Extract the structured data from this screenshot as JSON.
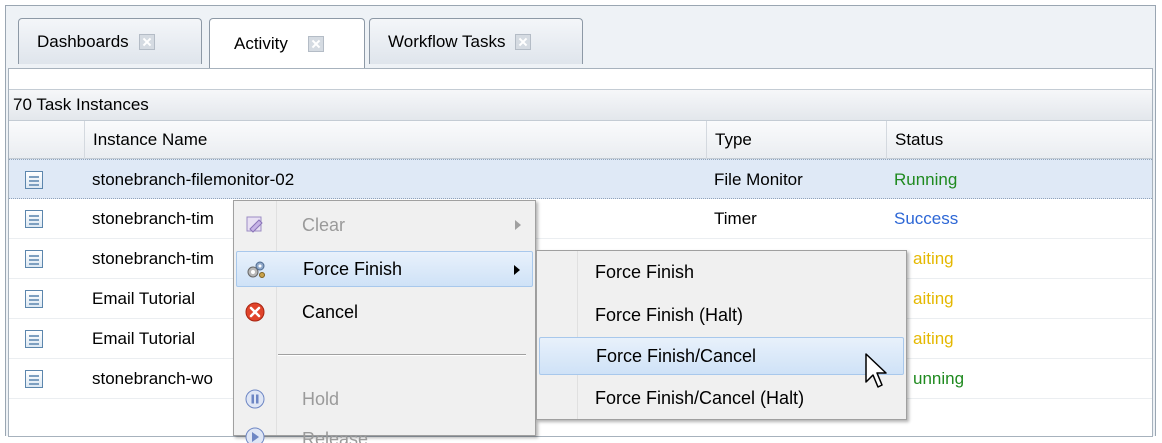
{
  "tabs": [
    {
      "label": "Dashboards"
    },
    {
      "label": "Activity"
    },
    {
      "label": "Workflow Tasks"
    }
  ],
  "grid": {
    "count_label": "70 Task Instances",
    "columns": {
      "name": "Instance Name",
      "type": "Type",
      "status": "Status"
    },
    "rows": [
      {
        "name": "stonebranch-filemonitor-02",
        "type": "File Monitor",
        "status": "Running",
        "status_color": "#1f8a1f"
      },
      {
        "name": "stonebranch-tim",
        "type": "Timer",
        "status": "Success",
        "status_color": "#2d67d6"
      },
      {
        "name": "stonebranch-tim",
        "type": "",
        "status": "aiting",
        "status_color": "#e5b800"
      },
      {
        "name": "Email Tutorial",
        "type": "",
        "status": "aiting",
        "status_color": "#e5b800"
      },
      {
        "name": "Email Tutorial",
        "type": "",
        "status": "aiting",
        "status_color": "#e5b800"
      },
      {
        "name": "stonebranch-wo",
        "type": "",
        "status": "unning",
        "status_color": "#1f8a1f"
      }
    ]
  },
  "context_menu": {
    "items": [
      {
        "label": "Clear",
        "icon": "eraser-icon",
        "disabled": true
      },
      {
        "label": "Force Finish",
        "icon": "gears-icon",
        "disabled": false
      },
      {
        "label": "Cancel",
        "icon": "cancel-circle-icon",
        "disabled": false
      },
      {
        "label": "Hold",
        "icon": "hold-pause-icon",
        "disabled": true
      },
      {
        "label": "Release",
        "icon": "release-icon",
        "disabled": true
      }
    ]
  },
  "submenu": {
    "items": [
      {
        "label": "Force Finish"
      },
      {
        "label": "Force Finish (Halt)"
      },
      {
        "label": "Force Finish/Cancel"
      },
      {
        "label": "Force Finish/Cancel (Halt)"
      }
    ]
  },
  "colors": {
    "accent": "#a8c8ec",
    "running": "#1f8a1f",
    "success": "#2d67d6",
    "waiting": "#e5b800"
  }
}
